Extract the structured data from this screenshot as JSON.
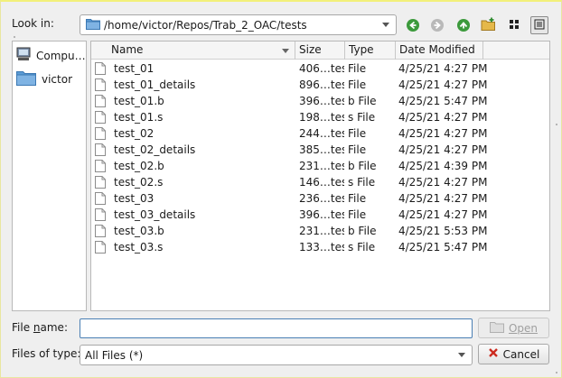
{
  "top": {
    "look_in_label": "Look in:",
    "path": "/home/victor/Repos/Trab_2_OAC/tests",
    "back_icon": "arrow-left-icon",
    "forward_icon": "arrow-right-icon",
    "up_icon": "arrow-up-icon",
    "new_folder_icon": "new-folder-icon",
    "list_view_icon": "list-view-icon",
    "detail_view_icon": "detail-view-icon"
  },
  "sidebar": {
    "items": [
      {
        "label": "Compu…",
        "icon": "computer-icon"
      },
      {
        "label": "victor",
        "icon": "folder-icon"
      }
    ]
  },
  "filelist": {
    "columns": [
      "Name",
      "Size",
      "Type",
      "Date Modified"
    ],
    "rows": [
      {
        "name": "test_01",
        "size": "406…tes",
        "type": "File",
        "date": "4/25/21 4:27 PM"
      },
      {
        "name": "test_01_details",
        "size": "896…tes",
        "type": "File",
        "date": "4/25/21 4:27 PM"
      },
      {
        "name": "test_01.b",
        "size": "396…tes",
        "type": "b File",
        "date": "4/25/21 5:47 PM"
      },
      {
        "name": "test_01.s",
        "size": "198…tes",
        "type": "s File",
        "date": "4/25/21 4:27 PM"
      },
      {
        "name": "test_02",
        "size": "244…tes",
        "type": "File",
        "date": "4/25/21 4:27 PM"
      },
      {
        "name": "test_02_details",
        "size": "385…tes",
        "type": "File",
        "date": "4/25/21 4:27 PM"
      },
      {
        "name": "test_02.b",
        "size": "231…tes",
        "type": "b File",
        "date": "4/25/21 4:39 PM"
      },
      {
        "name": "test_02.s",
        "size": "146…tes",
        "type": "s File",
        "date": "4/25/21 4:27 PM"
      },
      {
        "name": "test_03",
        "size": "236…tes",
        "type": "File",
        "date": "4/25/21 4:27 PM"
      },
      {
        "name": "test_03_details",
        "size": "396…tes",
        "type": "File",
        "date": "4/25/21 4:27 PM"
      },
      {
        "name": "test_03.b",
        "size": "231…tes",
        "type": "b File",
        "date": "4/25/21 5:53 PM"
      },
      {
        "name": "test_03.s",
        "size": "133…tes",
        "type": "s File",
        "date": "4/25/21 5:47 PM"
      }
    ]
  },
  "bottom": {
    "file_name_label": "File name:",
    "file_name_value": "",
    "files_of_type_label": "Files of type:",
    "files_of_type_value": "All Files (*)",
    "open_label": "Open",
    "cancel_label": "Cancel"
  },
  "colors": {
    "back_green": "#3c9a3c",
    "forward_gray": "#b9b9b9",
    "up_green": "#3c9a3c",
    "folder_blue": "#5b9bd5",
    "cancel_red": "#cc2a1f"
  }
}
